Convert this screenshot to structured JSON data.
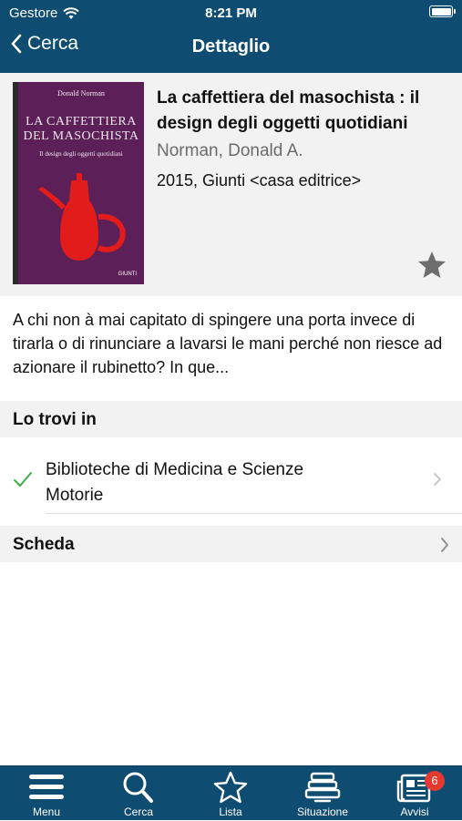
{
  "status_bar": {
    "carrier": "Gestore",
    "time": "8:21 PM"
  },
  "nav": {
    "back_label": "Cerca",
    "title": "Dettaglio"
  },
  "book": {
    "title": "La caffettiera del masochista : il design degli oggetti quotidiani",
    "author": "Norman, Donald A.",
    "publication": "2015, Giunti <casa editrice>",
    "cover": {
      "author": "Donald Norman",
      "title_line1": "LA CAFFETTIERA",
      "title_line2": "DEL MASOCHISTA",
      "subtitle": "Il design degli oggetti quotidiani",
      "publisher": "GIUNTI"
    }
  },
  "abstract": "A chi non à mai capitato di spingere una porta invece di tirarla o di rinunciare a lavarsi le mani perché non riesce ad azionare il rubinetto? In que...",
  "availability": {
    "header": "Lo trovi in",
    "locations": [
      {
        "name": "Biblioteche di Medicina e Scienze Motorie",
        "available": true
      }
    ]
  },
  "record": {
    "header": "Scheda"
  },
  "tabbar": {
    "items": [
      {
        "label": "Menu",
        "icon": "menu-icon"
      },
      {
        "label": "Cerca",
        "icon": "search-icon"
      },
      {
        "label": "Lista",
        "icon": "star-icon"
      },
      {
        "label": "Situazione",
        "icon": "books-icon"
      },
      {
        "label": "Avvisi",
        "icon": "news-icon",
        "badge": "6"
      }
    ]
  },
  "colors": {
    "bar": "#0f4c71",
    "check": "#3cb043",
    "badge": "#e5392f",
    "cover": "#5c1f57"
  }
}
